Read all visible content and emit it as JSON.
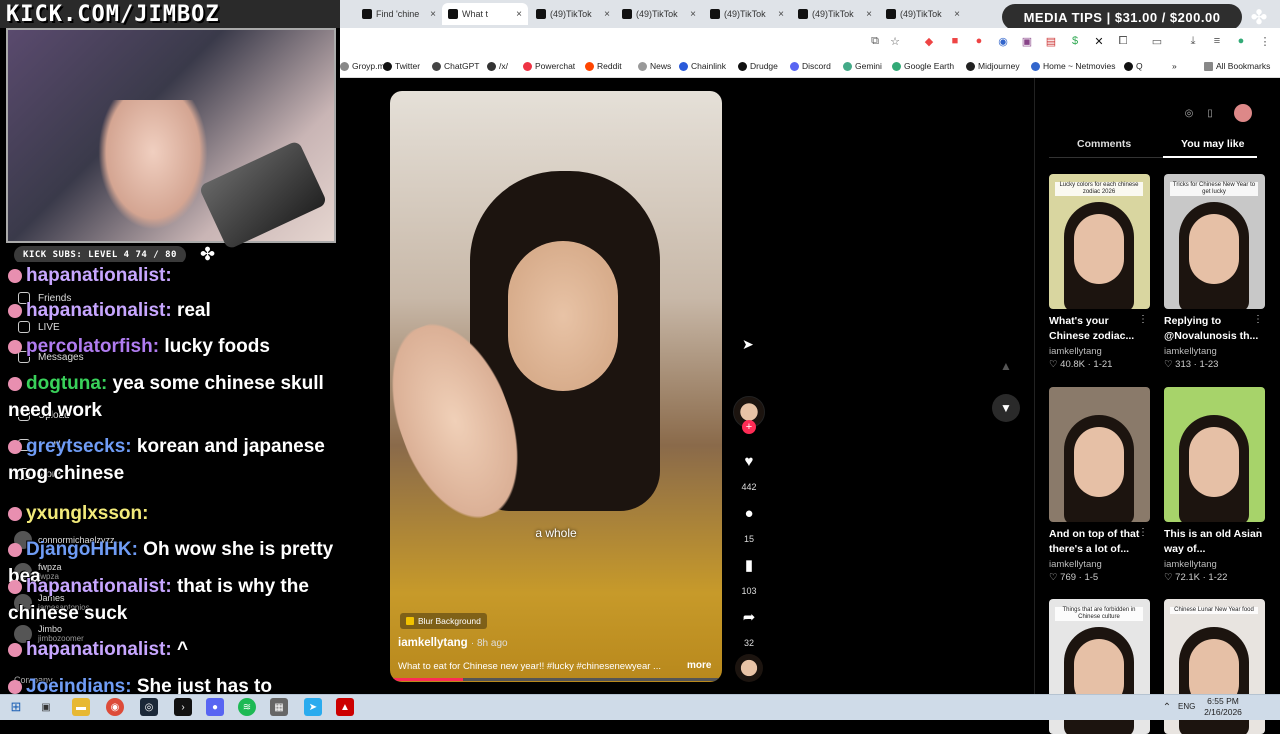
{
  "overlay": {
    "banner": "KICK.COM/JIMBOZ",
    "media_tips": "MEDIA TIPS | $31.00 / $200.00",
    "subs_goal": "KICK SUBS: LEVEL 4 74 / 80"
  },
  "browser": {
    "tabs": [
      {
        "label": "Find 'chine",
        "active": false
      },
      {
        "label": "What t",
        "active": true
      },
      {
        "label": "(49)TikTok",
        "active": false
      },
      {
        "label": "(49)TikTok",
        "active": false
      },
      {
        "label": "(49)TikTok",
        "active": false
      },
      {
        "label": "(49)TikTok",
        "active": false
      },
      {
        "label": "(49)TikTok",
        "active": false
      }
    ],
    "bookmarks": [
      {
        "label": "Groyp.me",
        "color": "#888"
      },
      {
        "label": "Twitter",
        "color": "#111"
      },
      {
        "label": "ChatGPT",
        "color": "#444"
      },
      {
        "label": "/x/",
        "color": "#333"
      },
      {
        "label": "Powerchat",
        "color": "#e34"
      },
      {
        "label": "Reddit",
        "color": "#ff4500"
      },
      {
        "label": "News",
        "color": "#999"
      },
      {
        "label": "Chainlink",
        "color": "#2a5ada"
      },
      {
        "label": "Drudge",
        "color": "#111"
      },
      {
        "label": "Discord",
        "color": "#5865f2"
      },
      {
        "label": "Gemini",
        "color": "#4a8"
      },
      {
        "label": "Google Earth",
        "color": "#3a7"
      },
      {
        "label": "Midjourney",
        "color": "#222"
      },
      {
        "label": "Home ~ Netmovies",
        "color": "#36c"
      },
      {
        "label": "Q",
        "color": "#111"
      }
    ],
    "all_bookmarks": "All Bookmarks"
  },
  "sidebar_nav": [
    {
      "label": "Friends"
    },
    {
      "label": "LIVE"
    },
    {
      "label": "Messages"
    },
    {
      "label": "Upload"
    },
    {
      "label": "Profile"
    },
    {
      "label": "More"
    }
  ],
  "following": [
    {
      "name": "connormichaelzyzz...",
      "handle": ""
    },
    {
      "name": "fwpza",
      "handle": "fwpza"
    },
    {
      "name": "James",
      "handle": "jamesantonios"
    },
    {
      "name": "Jimbo",
      "handle": "jimbozoomer"
    }
  ],
  "company_label": "Company",
  "chat": [
    {
      "user": "hapanationalist",
      "text": "",
      "color": "purple"
    },
    {
      "user": "hapanationalist",
      "text": "real",
      "color": "purple"
    },
    {
      "user": "percolatorfish",
      "text": "lucky foods",
      "color": "violet"
    },
    {
      "user": "dogtuna",
      "text": "yea some chinese skull need work",
      "color": "green"
    },
    {
      "user": "greytsecks",
      "text": "korean and japanese mog chinese",
      "color": "blue"
    },
    {
      "user": "yxunglxsson",
      "text": "",
      "color": "yellow"
    },
    {
      "user": "DjangoHHK",
      "text": "Oh wow she is pretty bea",
      "color": "blue"
    },
    {
      "user": "hapanationalist",
      "text": "that is why the chinese suck",
      "color": "purple"
    },
    {
      "user": "hapanationalist",
      "text": "^",
      "color": "purple"
    },
    {
      "user": "Joeindians",
      "text": "She just has to looksmaxx",
      "color": "blue"
    }
  ],
  "video": {
    "caption": "a whole",
    "blur_label": "Blur Background",
    "author": "iamkellytang",
    "time": "· 8h ago",
    "description": "What to eat for Chinese new year!! #lucky #chinesenewyear ...",
    "more": "more",
    "progress": 0.22,
    "likes": "442",
    "comments": "15",
    "saves": "103",
    "shares": "32"
  },
  "right_panel": {
    "tabs": [
      {
        "label": "Comments"
      },
      {
        "label": "You may like"
      }
    ],
    "cards": [
      {
        "title": "What's your Chinese zodiac...",
        "author": "iamkellytang",
        "stat": "40.8K · 1-21",
        "bg": "#d9d6a0",
        "overlay": "Lucky colors for each chinese zodiac 2026"
      },
      {
        "title": "Replying to @Novalunosis th...",
        "author": "iamkellytang",
        "stat": "313 · 1-23",
        "bg": "#c8c8c8",
        "overlay": "Tricks for Chinese New Year to get lucky"
      },
      {
        "title": "And on top of that there's a lot of...",
        "author": "iamkellytang",
        "stat": "769 · 1-5",
        "bg": "#8a7a6a",
        "overlay": ""
      },
      {
        "title": "This is an old Asian way of...",
        "author": "iamkellytang",
        "stat": "72.1K · 1-22",
        "bg": "#a7d36a",
        "overlay": ""
      },
      {
        "title": "",
        "author": "",
        "stat": "",
        "bg": "#e6e6e6",
        "overlay": "Things that are forbidden in Chinese culture"
      },
      {
        "title": "",
        "author": "",
        "stat": "",
        "bg": "#e8e4e0",
        "overlay": "Chinese Lunar New Year food"
      }
    ]
  },
  "taskbar": {
    "lang": "ENG",
    "time": "6:55 PM",
    "date": "2/16/2026"
  }
}
